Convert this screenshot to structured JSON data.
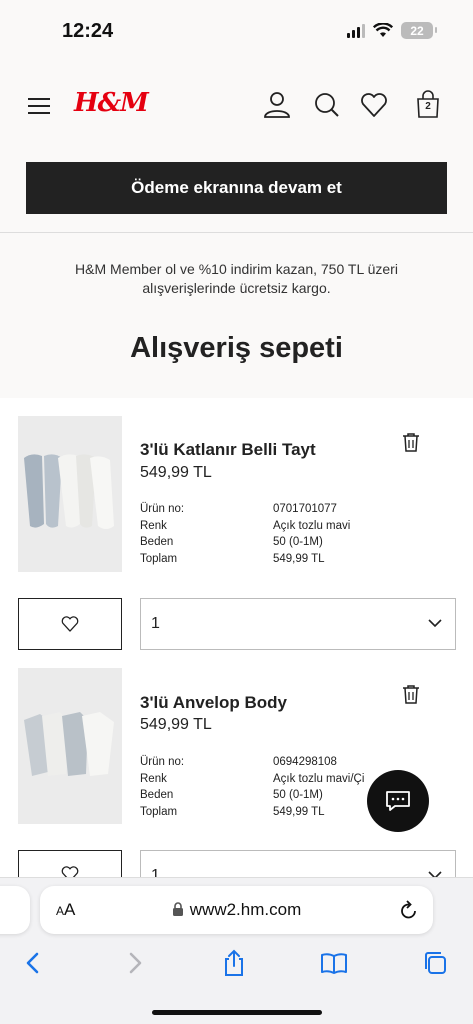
{
  "status": {
    "time": "12:24",
    "battery": "22"
  },
  "header": {
    "logo": "H&M",
    "bag_count": "2"
  },
  "checkout_label": "Ödeme ekranına devam et",
  "promo_text": "H&M Member ol ve %10 indirim kazan, 750 TL üzeri alışverişlerinde ücretsiz kargo.",
  "page_title": "Alışveriş sepeti",
  "items": [
    {
      "name": "3'lü Katlanır Belli Tayt",
      "price": "549,99 TL",
      "details": [
        {
          "label": "Ürün no:",
          "value": "0701701077"
        },
        {
          "label": "Renk",
          "value": "Açık tozlu mavi"
        },
        {
          "label": "Beden",
          "value": "50 (0-1M)"
        },
        {
          "label": "Toplam",
          "value": "549,99 TL"
        }
      ],
      "quantity": "1"
    },
    {
      "name": "3'lü Anvelop Body",
      "price": "549,99 TL",
      "details": [
        {
          "label": "Ürün no:",
          "value": "0694298108"
        },
        {
          "label": "Renk",
          "value": "Açık tozlu mavi/Çi"
        },
        {
          "label": "Beden",
          "value": "50 (0-1M)"
        },
        {
          "label": "Toplam",
          "value": "549,99 TL"
        }
      ],
      "quantity": "1"
    }
  ],
  "browser": {
    "aa": "AA",
    "url": "www2.hm.com"
  },
  "colors": {
    "brand_red": "#e50010",
    "dark": "#222222",
    "ios_blue": "#1a73e8"
  }
}
